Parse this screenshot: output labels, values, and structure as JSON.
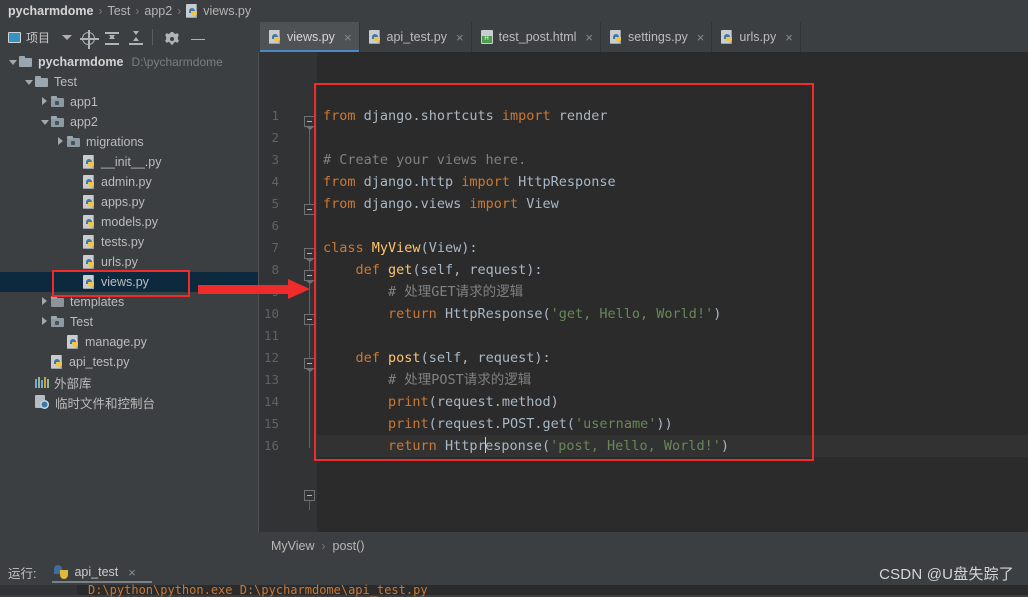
{
  "window": {
    "breadcrumb": [
      {
        "label": "pycharmdome",
        "bold": true,
        "icon": null
      },
      {
        "label": "Test",
        "bold": false,
        "icon": null
      },
      {
        "label": "app2",
        "bold": false,
        "icon": null
      },
      {
        "label": "views.py",
        "bold": false,
        "icon": "python-file-icon"
      }
    ],
    "separator": "›"
  },
  "project_toolbar": {
    "title": "项目",
    "icons": [
      {
        "name": "select-opened-file-icon",
        "title": "Select Opened File"
      },
      {
        "name": "collapse-all-icon",
        "title": "Collapse All"
      },
      {
        "name": "expand-all-icon",
        "title": "Expand All"
      },
      {
        "name": "settings-gear-icon",
        "title": "Settings"
      },
      {
        "name": "hide-panel-icon",
        "title": "Hide"
      }
    ]
  },
  "tabs": [
    {
      "label": "views.py",
      "icon": "python-file-icon",
      "active": true,
      "close": "×"
    },
    {
      "label": "api_test.py",
      "icon": "python-file-icon",
      "active": false,
      "close": "×"
    },
    {
      "label": "test_post.html",
      "icon": "html-file-icon",
      "active": false,
      "close": "×"
    },
    {
      "label": "settings.py",
      "icon": "python-file-icon",
      "active": false,
      "close": "×"
    },
    {
      "label": "urls.py",
      "icon": "python-file-icon",
      "active": false,
      "close": "×"
    }
  ],
  "tree": [
    {
      "label": "pycharmdome",
      "sub": "D:\\pycharmdome",
      "indent": 0,
      "arrow": "down",
      "icon": "folder-icon",
      "bold": true,
      "selected": false
    },
    {
      "label": "Test",
      "sub": "",
      "indent": 1,
      "arrow": "down",
      "icon": "folder-icon",
      "bold": false,
      "selected": false
    },
    {
      "label": "app1",
      "sub": "",
      "indent": 2,
      "arrow": "right",
      "icon": "module-folder-icon",
      "bold": false,
      "selected": false
    },
    {
      "label": "app2",
      "sub": "",
      "indent": 2,
      "arrow": "down",
      "icon": "module-folder-icon",
      "bold": false,
      "selected": false
    },
    {
      "label": "migrations",
      "sub": "",
      "indent": 3,
      "arrow": "right",
      "icon": "module-folder-icon",
      "bold": false,
      "selected": false
    },
    {
      "label": "__init__.py",
      "sub": "",
      "indent": 4,
      "arrow": "none",
      "icon": "python-file-icon",
      "bold": false,
      "selected": false
    },
    {
      "label": "admin.py",
      "sub": "",
      "indent": 4,
      "arrow": "none",
      "icon": "python-file-icon",
      "bold": false,
      "selected": false
    },
    {
      "label": "apps.py",
      "sub": "",
      "indent": 4,
      "arrow": "none",
      "icon": "python-file-icon",
      "bold": false,
      "selected": false
    },
    {
      "label": "models.py",
      "sub": "",
      "indent": 4,
      "arrow": "none",
      "icon": "python-file-icon",
      "bold": false,
      "selected": false
    },
    {
      "label": "tests.py",
      "sub": "",
      "indent": 4,
      "arrow": "none",
      "icon": "python-file-icon",
      "bold": false,
      "selected": false
    },
    {
      "label": "urls.py",
      "sub": "",
      "indent": 4,
      "arrow": "none",
      "icon": "python-file-icon",
      "bold": false,
      "selected": false
    },
    {
      "label": "views.py",
      "sub": "",
      "indent": 4,
      "arrow": "none",
      "icon": "python-file-icon",
      "bold": false,
      "selected": true
    },
    {
      "label": "templates",
      "sub": "",
      "indent": 2,
      "arrow": "right",
      "icon": "plain-folder-icon",
      "bold": false,
      "selected": false
    },
    {
      "label": "Test",
      "sub": "",
      "indent": 2,
      "arrow": "right",
      "icon": "module-folder-icon",
      "bold": false,
      "selected": false
    },
    {
      "label": "manage.py",
      "sub": "",
      "indent": 3,
      "arrow": "none",
      "icon": "python-file-icon",
      "bold": false,
      "selected": false
    },
    {
      "label": "api_test.py",
      "sub": "",
      "indent": 2,
      "arrow": "none",
      "icon": "python-file-icon",
      "bold": false,
      "selected": false
    },
    {
      "label": "外部库",
      "sub": "",
      "indent": 1,
      "arrow": "none",
      "icon": "external-libraries-icon",
      "bold": false,
      "selected": false
    },
    {
      "label": "临时文件和控制台",
      "sub": "",
      "indent": 1,
      "arrow": "none",
      "icon": "scratches-icon",
      "bold": false,
      "selected": false
    }
  ],
  "editor": {
    "filename": "views.py",
    "line_numbers": [
      1,
      2,
      3,
      4,
      5,
      6,
      7,
      8,
      9,
      10,
      11,
      12,
      13,
      14,
      15,
      16
    ],
    "current_line": 16,
    "lines": [
      {
        "n": 1,
        "text": "from django.shortcuts import render"
      },
      {
        "n": 2,
        "text": ""
      },
      {
        "n": 3,
        "text": "# Create your views here."
      },
      {
        "n": 4,
        "text": "from django.http import HttpResponse"
      },
      {
        "n": 5,
        "text": "from django.views import View"
      },
      {
        "n": 6,
        "text": ""
      },
      {
        "n": 7,
        "text": "class MyView(View):"
      },
      {
        "n": 8,
        "text": "    def get(self, request):"
      },
      {
        "n": 9,
        "text": "        # 处理GET请求的逻辑"
      },
      {
        "n": 10,
        "text": "        return HttpResponse('get, Hello, World!')"
      },
      {
        "n": 11,
        "text": ""
      },
      {
        "n": 12,
        "text": "    def post(self, request):"
      },
      {
        "n": 13,
        "text": "        # 处理POST请求的逻辑"
      },
      {
        "n": 14,
        "text": "        print(request.method)"
      },
      {
        "n": 15,
        "text": "        print(request.POST.get('username'))"
      },
      {
        "n": 16,
        "text": "        return HttpResponse('post, Hello, World!')"
      }
    ],
    "breadcrumb": [
      "MyView",
      "post()"
    ],
    "breadcrumb_separator": "›"
  },
  "run_panel": {
    "label": "运行:",
    "tab": "api_test",
    "close": "×",
    "console_text": "D:\\python\\python.exe D:\\pycharmdome\\api_test.py"
  },
  "watermark": "CSDN @U盘失踪了",
  "colors": {
    "accent_blue": "#4a88c7",
    "annotation_red": "#ef2b2b",
    "keyword": "#cc7832",
    "string": "#6a8759",
    "comment": "#808080",
    "identifier": "#a9b7c6",
    "function": "#ffc66d",
    "editor_bg": "#2b2b2b",
    "panel_bg": "#3c3f41",
    "selection_bg": "#0d293e"
  },
  "annotations": [
    {
      "name": "code-block-highlight",
      "type": "rect"
    },
    {
      "name": "views-file-highlight",
      "type": "rect"
    },
    {
      "name": "pointer-arrow",
      "type": "arrow"
    }
  ]
}
